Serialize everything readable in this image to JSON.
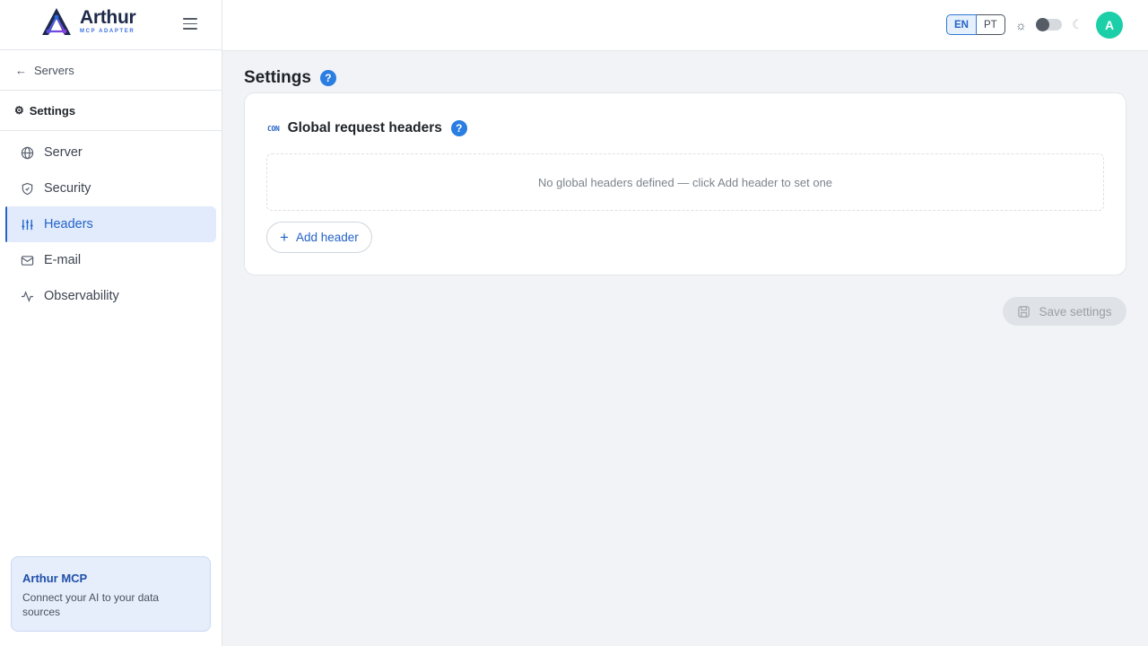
{
  "brand": {
    "name": "Arthur",
    "subtitle": "MCP ADAPTER"
  },
  "sidebar": {
    "back_label": "Servers",
    "section_title": "Settings",
    "items": [
      {
        "label": "Server",
        "icon": "globe-icon",
        "active": false
      },
      {
        "label": "Security",
        "icon": "shield-icon",
        "active": false
      },
      {
        "label": "Headers",
        "icon": "sliders-icon",
        "active": true
      },
      {
        "label": "E-mail",
        "icon": "mail-icon",
        "active": false
      },
      {
        "label": "Observability",
        "icon": "activity-icon",
        "active": false
      }
    ],
    "promo": {
      "title": "Arthur MCP",
      "description": "Connect your AI to your data sources"
    }
  },
  "topbar": {
    "languages": [
      "EN",
      "PT"
    ],
    "selected_language": "EN",
    "theme_dark": false,
    "avatar_initial": "A"
  },
  "main": {
    "page_title": "Settings",
    "help_glyph": "?",
    "card": {
      "icon_text": "CON",
      "title": "Global request headers",
      "empty_message": "No global headers defined — click Add header to set one",
      "add_label": "Add header"
    },
    "save_label": "Save settings",
    "save_disabled": true
  },
  "colors": {
    "accent": "#2463c9",
    "help": "#2a7de1",
    "avatar": "#1ccfa8",
    "active_bg": "#e1ebfb"
  }
}
